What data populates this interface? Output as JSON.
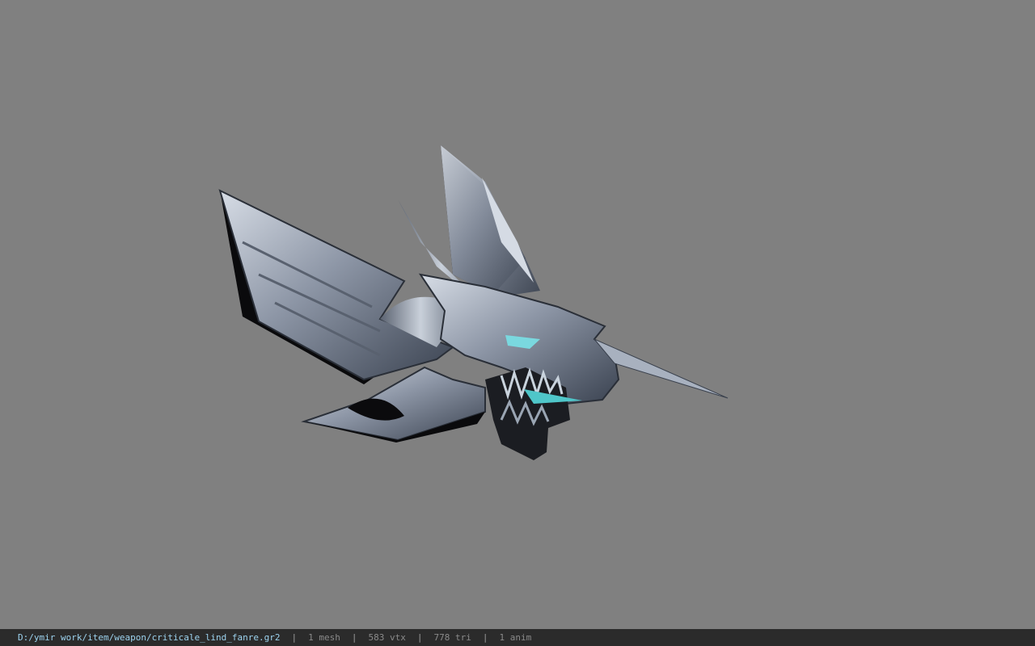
{
  "viewer": {
    "background_color": "#808080",
    "model_icon": "dragon-head-weapon-model"
  },
  "status": {
    "file_path": "D:/ymir work/item/weapon/criticale_lind_fanre.gr2",
    "separator": "|",
    "mesh": "1 mesh",
    "vertices": "583 vtx",
    "triangles": "778 tri",
    "animations": "1 anim",
    "path_color": "#9cd2ee"
  }
}
